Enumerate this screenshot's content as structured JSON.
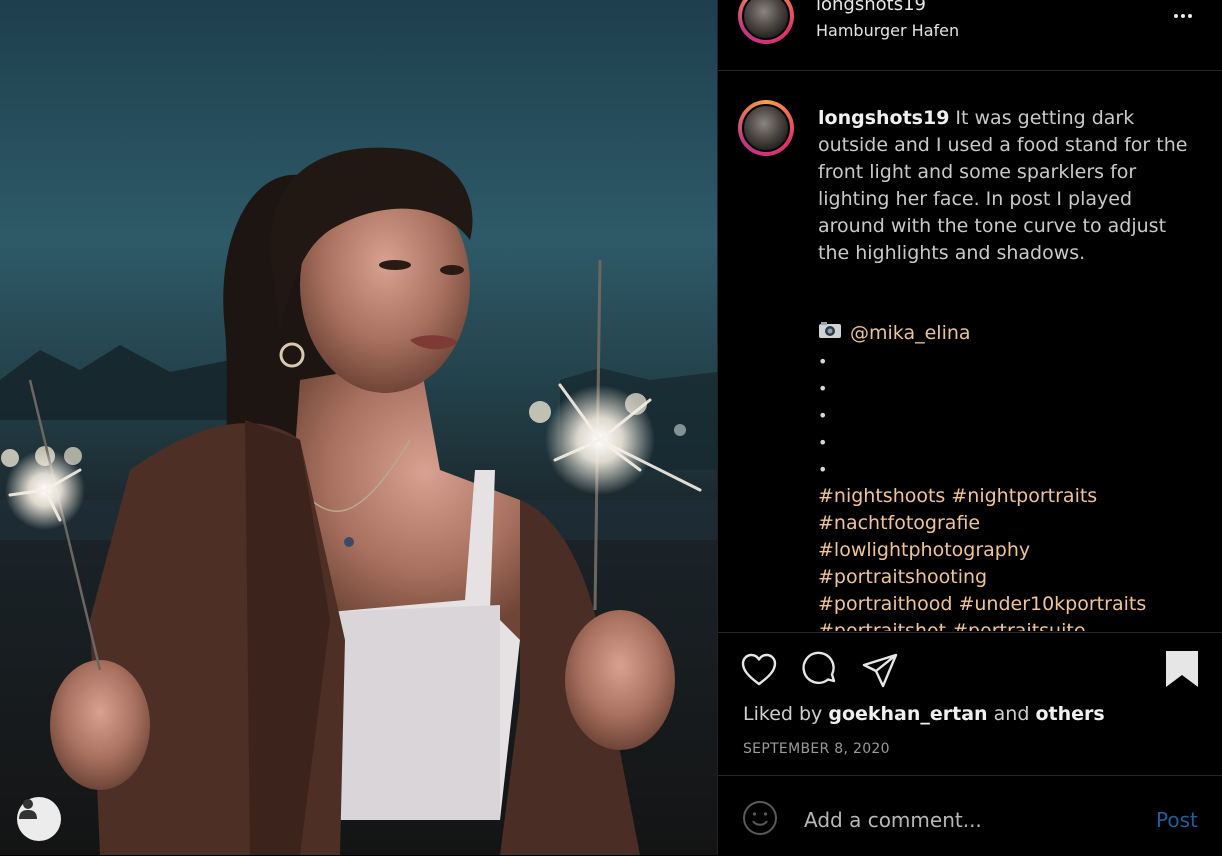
{
  "post": {
    "username": "longshots19",
    "location": "Hamburger Hafen",
    "caption": "It was getting dark outside and I used a food stand for the front light and some sparklers for lighting her face. In post I played around with the tone curve to adjust the highlights and shadows.",
    "credit_icon": "camera-icon",
    "credit_handle": "@mika_elina",
    "dots": [
      "•",
      "•",
      "•",
      "•",
      "•"
    ],
    "hashtags": [
      "#nightshoots #nightportraits",
      "#nachtfotografie",
      "#lowlightphotography",
      "#portraitshooting",
      "#portraithood #under10kportraits",
      "#portraitshot #portraitsuite"
    ],
    "liked_prefix": "Liked by",
    "liked_user": "goekhan_ertan",
    "liked_and": "and",
    "liked_others": "others",
    "date": "SEPTEMBER 8, 2020"
  },
  "comment": {
    "placeholder": "Add a comment...",
    "post_label": "Post"
  },
  "colors": {
    "background": "#000000",
    "hashtag": "#f2c495",
    "post_button": "#1e5f9c"
  },
  "icons": [
    "more-icon",
    "heart-icon",
    "comment-icon",
    "share-icon",
    "bookmark-icon",
    "emoji-icon",
    "user-tag-icon"
  ]
}
